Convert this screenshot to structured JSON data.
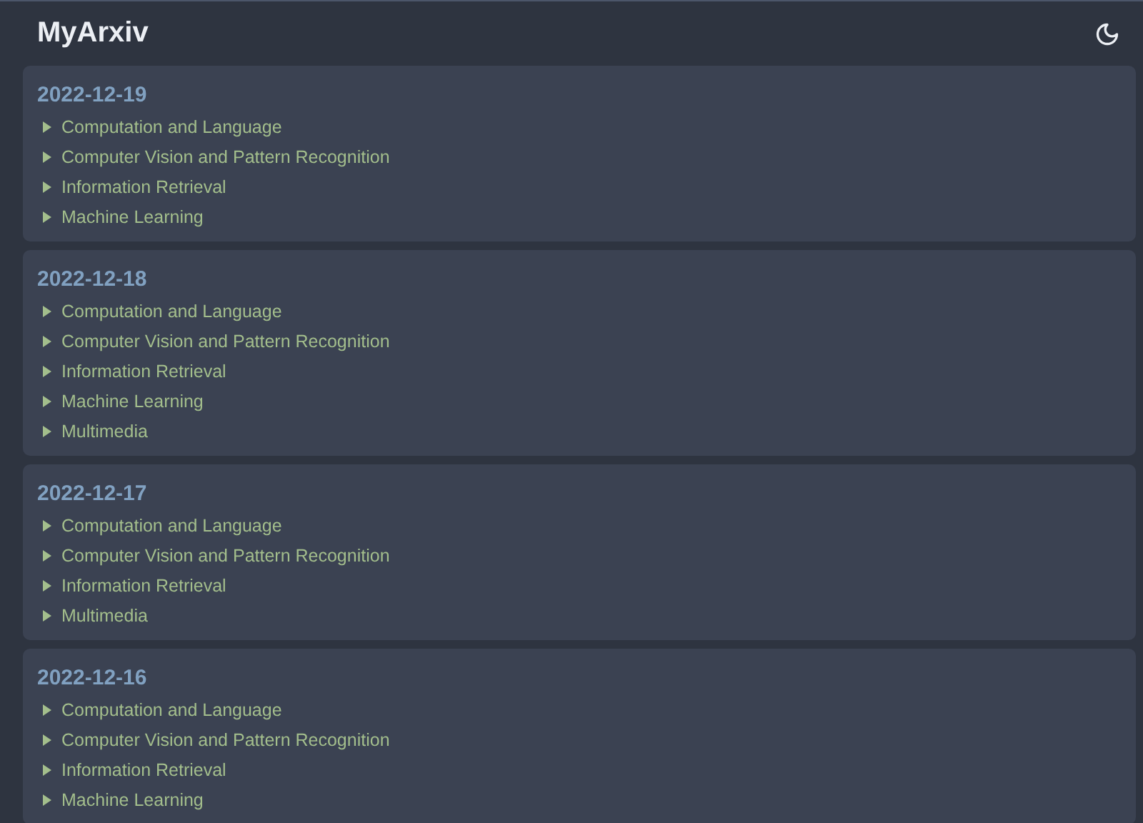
{
  "header": {
    "title": "MyArxiv"
  },
  "days": [
    {
      "date": "2022-12-19",
      "categories": [
        {
          "label": "Computation and Language",
          "expanded": false
        },
        {
          "label": "Computer Vision and Pattern Recognition",
          "expanded": false
        },
        {
          "label": "Information Retrieval",
          "expanded": false
        },
        {
          "label": "Machine Learning",
          "expanded": false
        }
      ]
    },
    {
      "date": "2022-12-18",
      "categories": [
        {
          "label": "Computation and Language",
          "expanded": false
        },
        {
          "label": "Computer Vision and Pattern Recognition",
          "expanded": false
        },
        {
          "label": "Information Retrieval",
          "expanded": false
        },
        {
          "label": "Machine Learning",
          "expanded": false
        },
        {
          "label": "Multimedia",
          "expanded": false
        }
      ]
    },
    {
      "date": "2022-12-17",
      "categories": [
        {
          "label": "Computation and Language",
          "expanded": false
        },
        {
          "label": "Computer Vision and Pattern Recognition",
          "expanded": false
        },
        {
          "label": "Information Retrieval",
          "expanded": false
        },
        {
          "label": "Multimedia",
          "expanded": false
        }
      ]
    },
    {
      "date": "2022-12-16",
      "categories": [
        {
          "label": "Computation and Language",
          "expanded": false
        },
        {
          "label": "Computer Vision and Pattern Recognition",
          "expanded": false
        },
        {
          "label": "Information Retrieval",
          "expanded": false
        },
        {
          "label": "Machine Learning",
          "expanded": false
        }
      ]
    }
  ]
}
